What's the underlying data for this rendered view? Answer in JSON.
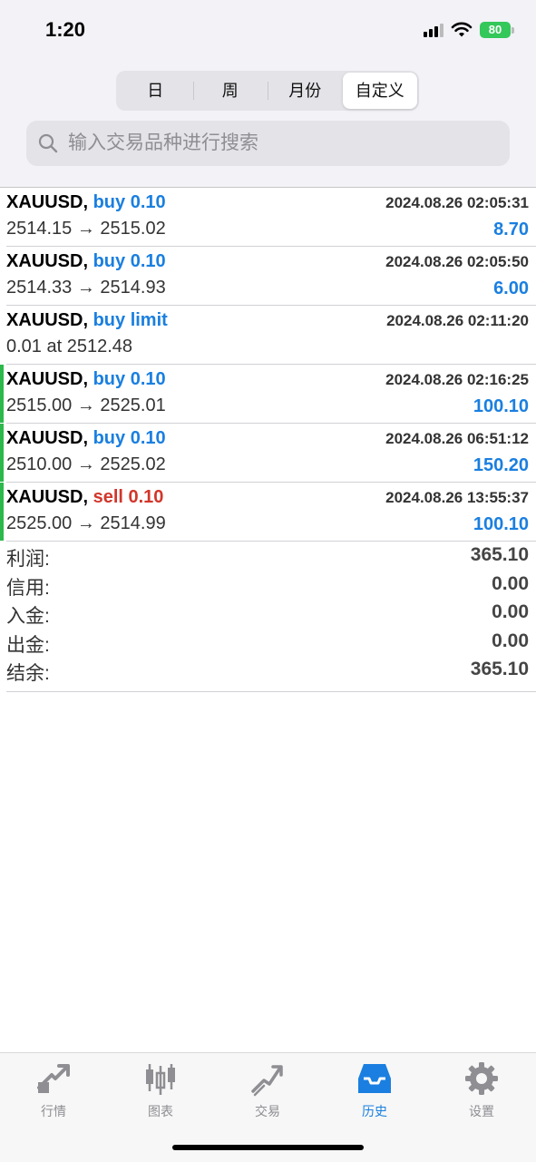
{
  "status_bar": {
    "time": "1:20",
    "battery": "80"
  },
  "segments": [
    {
      "label": "日",
      "active": false
    },
    {
      "label": "周",
      "active": false
    },
    {
      "label": "月份",
      "active": false
    },
    {
      "label": "自定义",
      "active": true
    }
  ],
  "search": {
    "placeholder": "输入交易品种进行搜索"
  },
  "trades": [
    {
      "symbol": "XAUUSD,",
      "side": "buy 0.10",
      "side_type": "buy",
      "date": "2024.08.26 02:05:31",
      "detail": "2514.15 → 2515.02",
      "profit": "8.70",
      "closed": false
    },
    {
      "symbol": "XAUUSD,",
      "side": "buy 0.10",
      "side_type": "buy",
      "date": "2024.08.26 02:05:50",
      "detail": "2514.33 → 2514.93",
      "profit": "6.00",
      "closed": false
    },
    {
      "symbol": "XAUUSD,",
      "side": "buy limit",
      "side_type": "buy",
      "date": "2024.08.26 02:11:20",
      "detail": "0.01 at 2512.48",
      "profit": "",
      "closed": false
    },
    {
      "symbol": "XAUUSD,",
      "side": "buy 0.10",
      "side_type": "buy",
      "date": "2024.08.26 02:16:25",
      "detail": "2515.00 → 2525.01",
      "profit": "100.10",
      "closed": true
    },
    {
      "symbol": "XAUUSD,",
      "side": "buy 0.10",
      "side_type": "buy",
      "date": "2024.08.26 06:51:12",
      "detail": "2510.00 → 2525.02",
      "profit": "150.20",
      "closed": true
    },
    {
      "symbol": "XAUUSD,",
      "side": "sell 0.10",
      "side_type": "sell",
      "date": "2024.08.26 13:55:37",
      "detail": "2525.00 → 2514.99",
      "profit": "100.10",
      "closed": true
    }
  ],
  "summary": [
    {
      "label": "利润:",
      "value": "365.10"
    },
    {
      "label": "信用:",
      "value": "0.00"
    },
    {
      "label": "入金:",
      "value": "0.00"
    },
    {
      "label": "出金:",
      "value": "0.00"
    },
    {
      "label": "结余:",
      "value": "365.10"
    }
  ],
  "tabbar": [
    {
      "label": "行情",
      "icon": "quotes-icon",
      "active": false
    },
    {
      "label": "图表",
      "icon": "chart-icon",
      "active": false
    },
    {
      "label": "交易",
      "icon": "trade-icon",
      "active": false
    },
    {
      "label": "历史",
      "icon": "history-icon",
      "active": true
    },
    {
      "label": "设置",
      "icon": "settings-icon",
      "active": false
    }
  ],
  "colors": {
    "accent": "#1a7fe0",
    "sell": "#d2362b",
    "closed_bar": "#2db84c",
    "inactive": "#8e8e93"
  }
}
